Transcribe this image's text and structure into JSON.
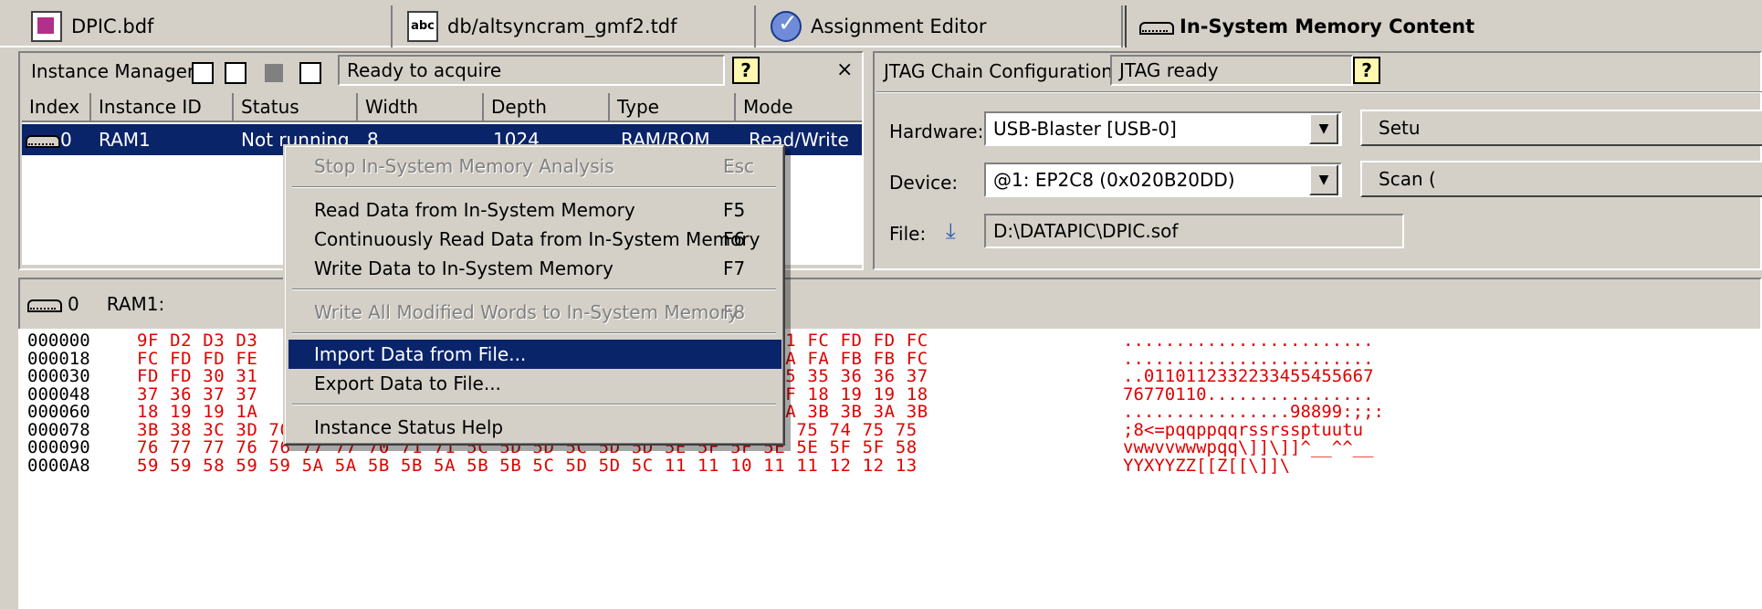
{
  "tabs": [
    {
      "label": "DPIC.bdf",
      "icon": "schematic-file-icon"
    },
    {
      "label": "db/altsyncram_gmf2.tdf",
      "icon": "text-file-icon"
    },
    {
      "label": "Assignment Editor",
      "icon": "assignment-editor-icon"
    },
    {
      "label": "In-System Memory Content",
      "icon": "memory-icon"
    }
  ],
  "instance_manager": {
    "label": "Instance Manager:",
    "status": "Ready to acquire",
    "help": "?",
    "close": "×",
    "columns": [
      "Index",
      "Instance ID",
      "Status",
      "Width",
      "Depth",
      "Type",
      "Mode"
    ],
    "row": {
      "index": "0",
      "id": "RAM1",
      "status": "Not running",
      "width": "8",
      "depth": "1024",
      "type": "RAM/ROM",
      "mode": "Read/Write"
    }
  },
  "jtag": {
    "label": "JTAG Chain Configuration:",
    "status": "JTAG ready",
    "help": "?",
    "hardware_label": "Hardware:",
    "hardware_value": "USB-Blaster [USB-0]",
    "setup_button": "Setu",
    "device_label": "Device:",
    "device_value": "@1: EP2C8 (0x020B20DD)",
    "scan_button": "Scan (",
    "file_label": "File:",
    "file_value": "D:\\DATAPIC\\DPIC.sof"
  },
  "memory_view": {
    "index": "0",
    "name": "RAM1:",
    "rows": [
      {
        "addr": "000000",
        "bytes": "9F D2 D3 D3                                      D7 D4 D0 D1 FC FD FD FC",
        "ascii": "........................"
      },
      {
        "addr": "000018",
        "bytes": "FC FD FD FE                                      FA FB FB FA FA FB FB FC",
        "ascii": "........................"
      },
      {
        "addr": "000030",
        "bytes": "FD FD 30 31                                      35 35 34 35 35 36 36 37",
        "ascii": "..0110112332233455455667"
      },
      {
        "addr": "000048",
        "bytes": "37 36 37 37                                      1F 1E 1F 1F 18 19 19 18",
        "ascii": "76770110................"
      },
      {
        "addr": "000060",
        "bytes": "18 19 19 1A                                      38 39 39 3A 3B 3B 3A 3B",
        "ascii": "................98899:;;:"
      },
      {
        "addr": "000078",
        "bytes": "3B 38 3C 3D 70 71 71 70 70 71 71 72 73 73 72 73 73 70 74 75 75 74 75 75",
        "ascii": ";8<=pqqppqqrssrssptuutu"
      },
      {
        "addr": "000090",
        "bytes": "76 77 77 76 76 77 77 70 71 71 5C 5D 5D 5C 5D 5D 5E 5F 5F 5E 5E 5F 5F 58",
        "ascii": "vwwvvwwwpqq\\]]\\]]^__^^__"
      },
      {
        "addr": "0000A8",
        "bytes": "59 59 58 59 59 5A 5A 5B 5B 5A 5B 5B 5C 5D 5D 5C 11 11 10 11 11 12 12 13",
        "ascii": "YYXYYZZ[[Z[[\\]]\\"
      }
    ]
  },
  "context_menu": {
    "items": [
      {
        "label": "Stop In-System Memory Analysis",
        "shortcut": "Esc",
        "disabled": true
      },
      {
        "label": "Read Data from In-System Memory",
        "shortcut": "F5",
        "disabled": false
      },
      {
        "label": "Continuously Read Data from In-System Memory",
        "shortcut": "F6",
        "disabled": false
      },
      {
        "label": "Write Data to In-System Memory",
        "shortcut": "F7",
        "disabled": false
      },
      {
        "label": "Write All Modified Words to In-System Memory",
        "shortcut": "F8",
        "disabled": true
      },
      {
        "label": "Import Data from File...",
        "shortcut": "",
        "disabled": false,
        "highlighted": true
      },
      {
        "label": "Export Data to File...",
        "shortcut": "",
        "disabled": false
      },
      {
        "label": "Instance Status Help",
        "shortcut": "",
        "disabled": false
      }
    ]
  }
}
